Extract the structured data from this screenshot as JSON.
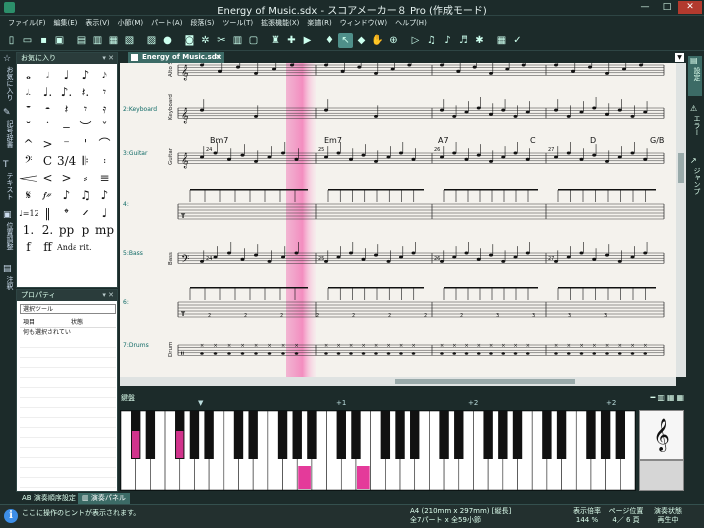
{
  "window": {
    "title": "Energy of Music.sdx - スコアメーカー８ Pro (作成モード)",
    "min": "—",
    "max": "□",
    "close": "✕"
  },
  "menu": [
    "ファイル(F)",
    "編集(E)",
    "表示(V)",
    "小節(M)",
    "パート(A)",
    "段落(S)",
    "ツール(T)",
    "拡張機能(X)",
    "楽譜(R)",
    "ウィンドウ(W)",
    "ヘルプ(H)"
  ],
  "toolbar_icons": [
    "new-icon",
    "open-icon",
    "save-icon",
    "print-preview-icon",
    "sep",
    "page-view-icon",
    "scroll-view-icon",
    "sheet-icon",
    "score-icon",
    "sep",
    "piano-roll-icon",
    "rec-icon",
    "sep",
    "camera-icon",
    "gear-icon",
    "cut-icon",
    "trash-icon",
    "panel-icon",
    "sep",
    "metronome-icon",
    "add-icon",
    "play-icon",
    "sep",
    "note-input-icon",
    "select-icon",
    "eraser-icon",
    "hand-icon",
    "zoom-icon",
    "sep",
    "playback-icon",
    "note-icon",
    "chord-icon",
    "music-icon",
    "gears-icon",
    "sep",
    "grid-icon",
    "ok-icon"
  ],
  "panels": {
    "favorites_title": "お気に入り",
    "favorites": [
      "𝅝",
      "𝅗𝅥",
      "♩",
      "♪",
      "𝅘𝅥𝅯",
      "𝅗𝅥.",
      "♩.",
      "♪.",
      "𝄽.",
      "𝄾",
      "𝄻",
      "𝄼",
      "𝄽",
      "𝄾",
      "𝄿",
      "˘",
      "˙",
      "‒",
      "︶",
      "ˇ",
      "^",
      ">",
      "⁻",
      "'",
      "⌒",
      "𝄢",
      "C",
      "3/4",
      "𝄆",
      "𝄈",
      "𝆒",
      "<",
      ">",
      "⸗",
      "≡",
      "𝄋",
      "𝆑𝄏",
      "♪",
      "♫",
      "♪",
      "♩=120",
      "‖",
      "𝄌",
      "𝄍",
      "♩",
      "1.",
      "2.",
      "pp",
      "p",
      "mp",
      "f",
      "ff",
      "Andante",
      "rit.",
      ""
    ],
    "properties_title": "プロパティ",
    "properties_select": "選択ツール",
    "properties_col_item": "項目",
    "properties_col_state": "状態",
    "properties_row": "何も選択されてい"
  },
  "left_tabs": [
    "お気に入り",
    "記号辞書",
    "テキスト",
    "位置調整",
    "注釈"
  ],
  "right_tabs": [
    "設定",
    "エラー",
    "ジャンプ"
  ],
  "document": {
    "tab": "Energy of Music.sdx",
    "staves": [
      {
        "label": "",
        "inst": "Alto S"
      },
      {
        "label": "2:Keyboard",
        "inst": "Keyboard"
      },
      {
        "label": "3:Guitar",
        "inst": "Guitar"
      },
      {
        "label": "4:",
        "inst": ""
      },
      {
        "label": "5:Bass",
        "inst": "Bass"
      },
      {
        "label": "6:",
        "inst": ""
      },
      {
        "label": "7:Drums",
        "inst": "Drum"
      }
    ],
    "chords": [
      "Bm7",
      "Em7",
      "A7",
      "C",
      "D",
      "G/B"
    ],
    "measure_numbers": [
      "24",
      "25",
      "26",
      "27"
    ],
    "tab_numbers": [
      "2",
      "2",
      "2",
      "2",
      "2",
      "2",
      "2",
      "2",
      "3",
      "3",
      "3",
      "3"
    ]
  },
  "keyboard": {
    "title": "鍵盤",
    "octaves": [
      "+1",
      "+2",
      "+2"
    ],
    "tools": [
      "━",
      "▥",
      "▦",
      "▦"
    ],
    "clef": "𝄞"
  },
  "bottom_tabs": [
    "演奏順序設定",
    "演奏パネル"
  ],
  "status": {
    "hint": "ここに操作のヒントが表示されます。",
    "paper_line1": "A4 (210mm x 297mm) [縦長]",
    "paper_line2": "全7パート x 全59小節",
    "zoom_label": "表示倍率",
    "zoom_value": "144 %",
    "page_label": "ページ位置",
    "page_value": "4／ 6 頁",
    "play_label": "演奏状態",
    "play_value": "再生中"
  }
}
